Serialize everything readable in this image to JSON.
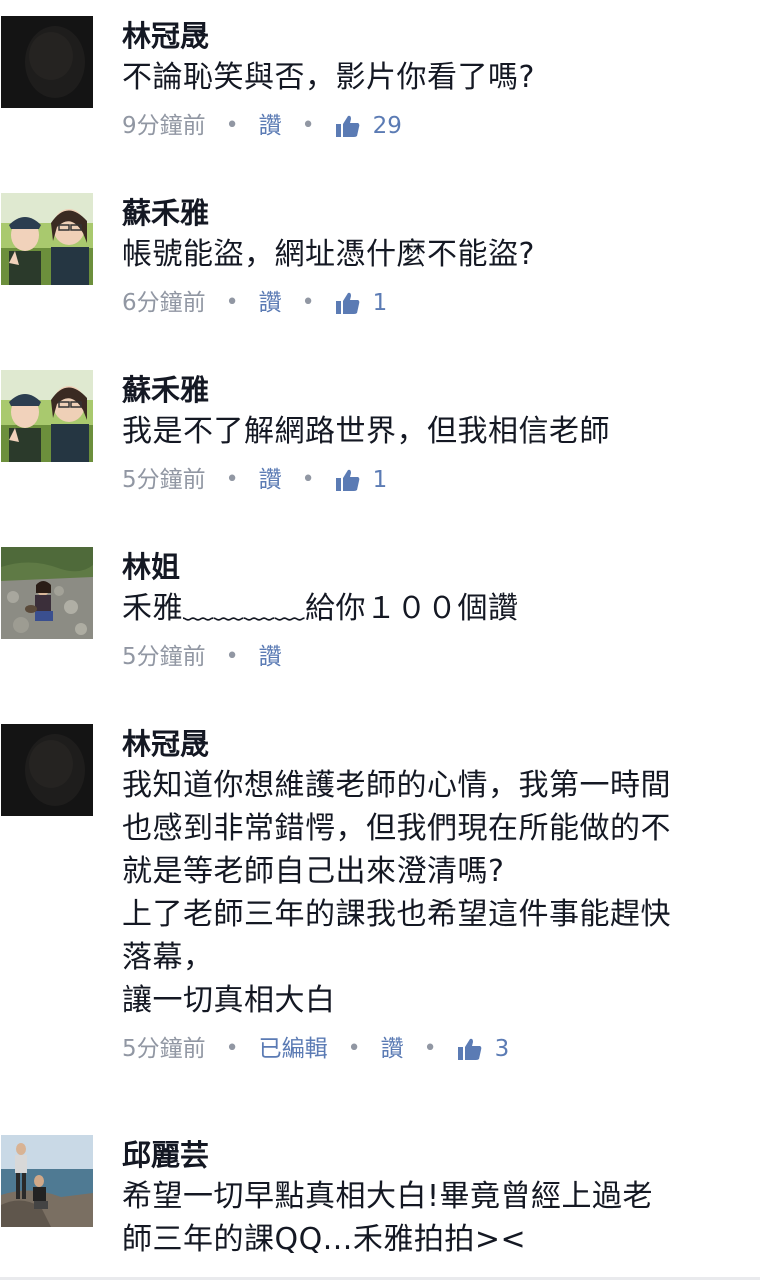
{
  "comments": [
    {
      "name": "林冠晟",
      "text": "不論恥笑與否，影片你看了嗎?",
      "time": "9分鐘前",
      "like_label": "讚",
      "likes": "29",
      "avatar": "dark-profile-photo"
    },
    {
      "name": "蘇禾雅",
      "text": "帳號能盜，網址憑什麼不能盜?",
      "time": "6分鐘前",
      "like_label": "讚",
      "likes": "1",
      "avatar": "two-people-outdoor-photo"
    },
    {
      "name": "蘇禾雅",
      "text": "我是不了解網路世界，但我相信老師",
      "time": "5分鐘前",
      "like_label": "讚",
      "likes": "1",
      "avatar": "two-people-outdoor-photo"
    },
    {
      "name": "林姐",
      "text": "禾雅﹏﹏﹏﹏給你１００個讚",
      "time": "5分鐘前",
      "like_label": "讚",
      "avatar": "person-on-rocks-photo"
    },
    {
      "name": "林冠晟",
      "text": "我知道你想維護老師的心情，我第一時間\n也感到非常錯愕，但我們現在所能做的不\n就是等老師自己出來澄清嗎?\n上了老師三年的課我也希望這件事能趕快\n落幕，\n讓一切真相大白",
      "time": "5分鐘前",
      "edited_label": "已編輯",
      "like_label": "讚",
      "likes": "3",
      "avatar": "dark-profile-photo"
    },
    {
      "name": "邱麗芸",
      "text": "希望一切早點真相大白!畢竟曾經上過老\n師三年的課QQ...禾雅拍拍><",
      "avatar": "seaside-couple-photo"
    }
  ],
  "colors": {
    "name": "#141823",
    "meta": "#9197a3",
    "action": "#5b7bb4"
  }
}
